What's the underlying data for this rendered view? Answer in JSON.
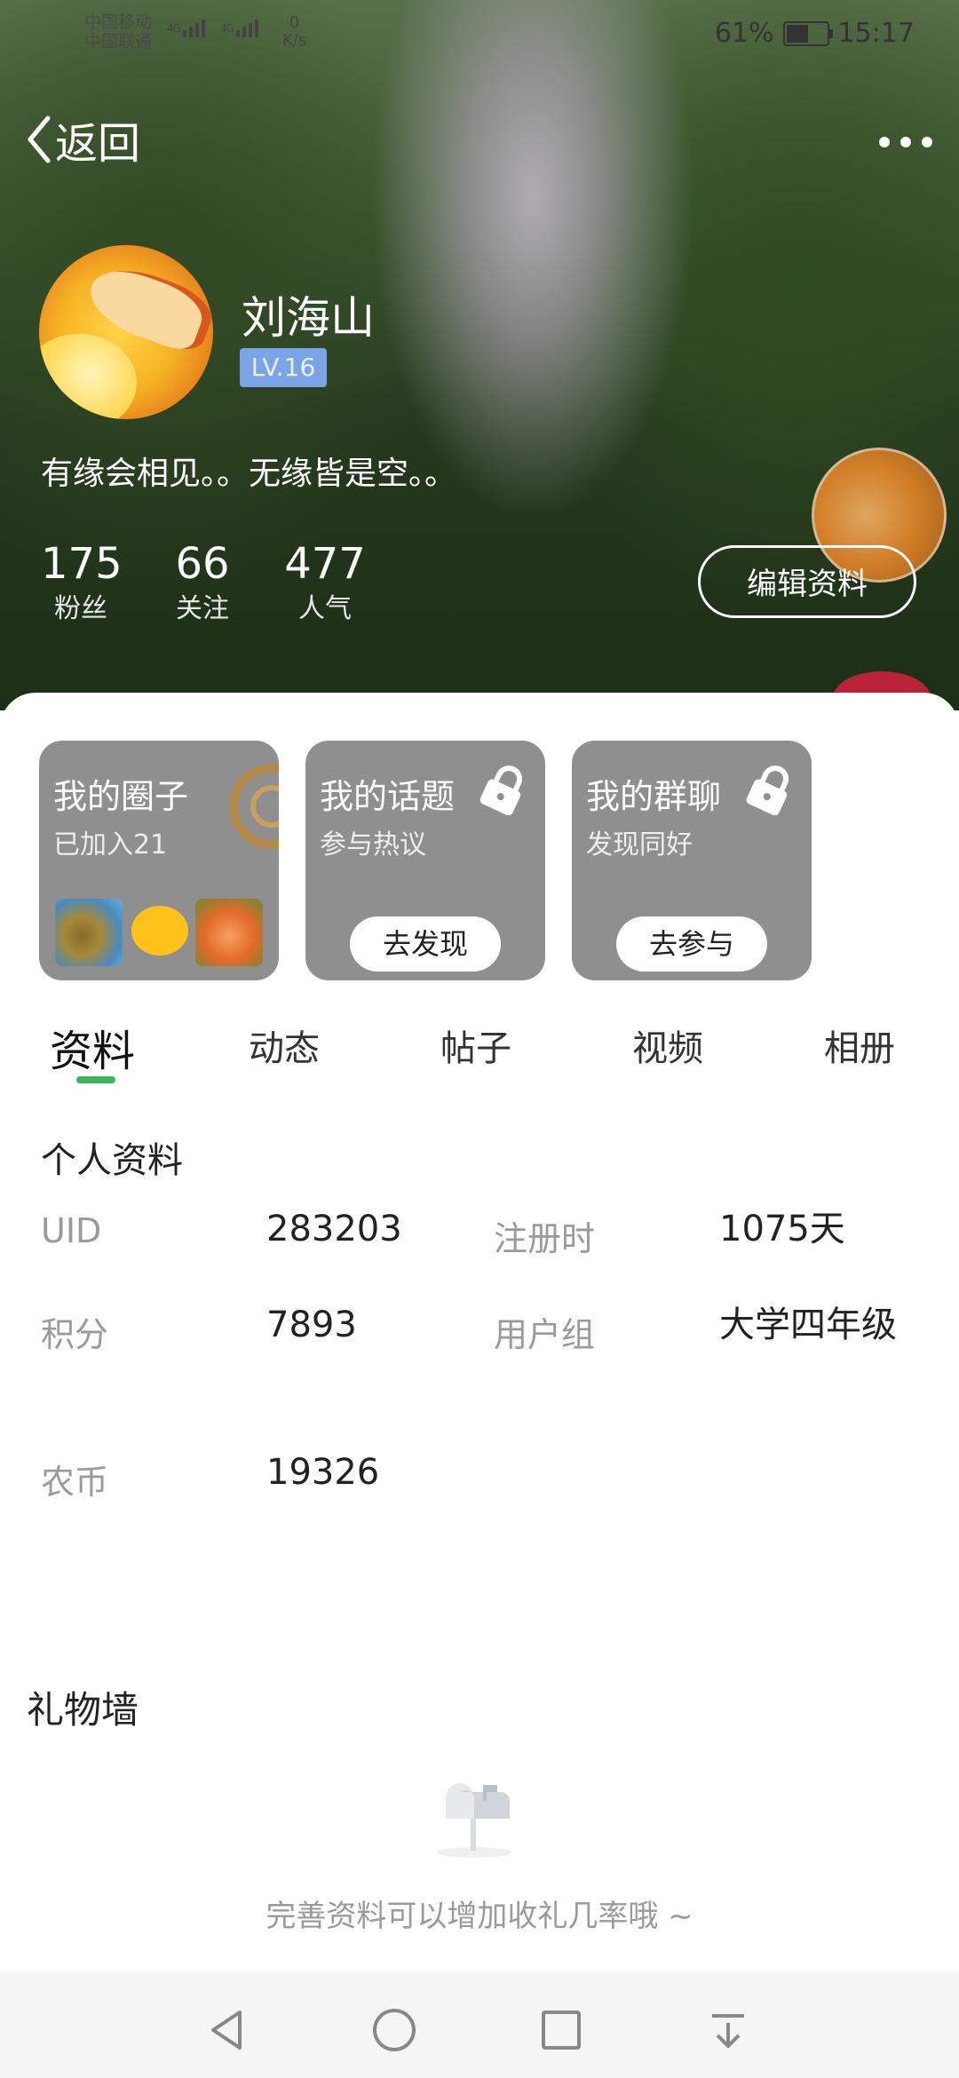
{
  "status_bar": {
    "carrier_1": "中国移动",
    "carrier_2": "中国联通",
    "network_1": "4G",
    "network_2": "4G",
    "speed_value": "0",
    "speed_unit": "K/s",
    "battery": "61%",
    "battery_level": 0.61,
    "time": "15:17"
  },
  "header": {
    "back_label": "返回"
  },
  "profile": {
    "name": "刘海山",
    "level": "LV.16",
    "bio": "有缘会相见。。无缘皆是空。。",
    "stats": [
      {
        "value": "175",
        "label": "粉丝"
      },
      {
        "value": "66",
        "label": "关注"
      },
      {
        "value": "477",
        "label": "人气"
      }
    ],
    "edit_button": "编辑资料"
  },
  "cards": [
    {
      "title": "我的圈子",
      "subtitle": "已加入21"
    },
    {
      "title": "我的话题",
      "subtitle": "参与热议",
      "button": "去发现"
    },
    {
      "title": "我的群聊",
      "subtitle": "发现同好",
      "button": "去参与"
    }
  ],
  "tabs": [
    "资料",
    "动态",
    "帖子",
    "视频",
    "相册"
  ],
  "personal_info": {
    "title": "个人资料",
    "rows": [
      {
        "label": "UID",
        "value": "283203"
      },
      {
        "label": "注册时",
        "value": "1075天"
      },
      {
        "label": "积分",
        "value": "7893"
      },
      {
        "label": "用户组",
        "value": "大学四年级"
      },
      {
        "label": "农币",
        "value": "19326"
      }
    ]
  },
  "gift_wall": {
    "title": "礼物墙",
    "empty_text": "完善资料可以增加收礼几率哦 ~"
  },
  "colors": {
    "accent_green": "#3ab55a",
    "level_badge": "#7ba4e6",
    "card_gray": "#8f8f8f"
  }
}
